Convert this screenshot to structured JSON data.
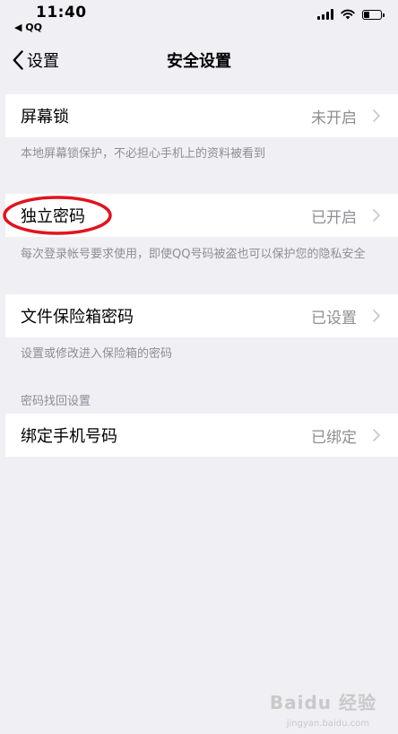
{
  "status_bar": {
    "time": "11:40",
    "back_app": "◀ QQ"
  },
  "nav": {
    "back_label": "设置",
    "title": "安全设置"
  },
  "cells": [
    {
      "label": "屏幕锁",
      "value": "未开启",
      "note": "本地屏幕锁保护，不必担心手机上的资料被看到"
    },
    {
      "label": "独立密码",
      "value": "已开启",
      "note": "每次登录帐号要求使用，即使QQ号码被盗也可以保护您的隐私安全"
    },
    {
      "label": "文件保险箱密码",
      "value": "已设置",
      "note": "设置或修改进入保险箱的密码"
    }
  ],
  "recovery_section": {
    "header": "密码找回设置",
    "cell": {
      "label": "绑定手机号码",
      "value": "已绑定"
    }
  },
  "annotation": {
    "color": "#e0141e"
  },
  "watermark": {
    "text": "Baidu 经验",
    "sub": "jingyan.baidu.com"
  },
  "icons": {
    "chevron": "chevron-right-icon",
    "back": "chevron-left-icon",
    "signal": "signal-icon",
    "wifi": "wifi-icon",
    "battery": "battery-icon"
  }
}
